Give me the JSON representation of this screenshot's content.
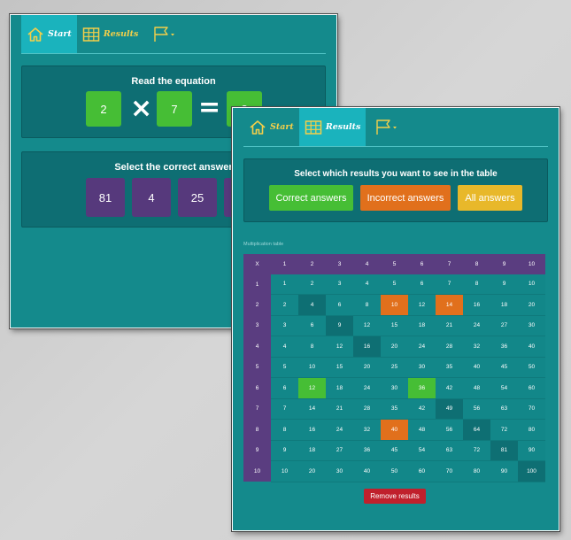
{
  "nav": {
    "start_label": "Start",
    "results_label": "Results",
    "language_icon": "flag-icon"
  },
  "quiz": {
    "read_title": "Read the equation",
    "equation": {
      "left": "2",
      "operator": "×",
      "right": "7",
      "equals": "=",
      "result": "?"
    },
    "select_title": "Select the correct answer",
    "answers": [
      "81",
      "4",
      "25",
      ""
    ]
  },
  "results": {
    "filter_title": "Select which results you want to see in the table",
    "filters": {
      "correct": "Correct answers",
      "incorrect": "Incorrect answers",
      "all": "All answers"
    },
    "table_title": "Multiplication table",
    "corner_label": "X",
    "headers": [
      "1",
      "2",
      "3",
      "4",
      "5",
      "6",
      "7",
      "8",
      "9",
      "10"
    ],
    "correct_cells": [
      [
        6,
        2
      ],
      [
        6,
        6
      ]
    ],
    "incorrect_cells": [
      [
        2,
        5
      ],
      [
        2,
        7
      ],
      [
        8,
        5
      ]
    ],
    "remove_label": "Remove results"
  },
  "colors": {
    "background_teal": "#148a8c",
    "panel_teal": "#0e6e73",
    "tab_active": "#1ab3bd",
    "nav_yellow": "#f4cf49",
    "green": "#46be35",
    "orange": "#e1701c",
    "yellow": "#e8b82a",
    "purple": "#5a3d80",
    "red": "#c0202c"
  }
}
